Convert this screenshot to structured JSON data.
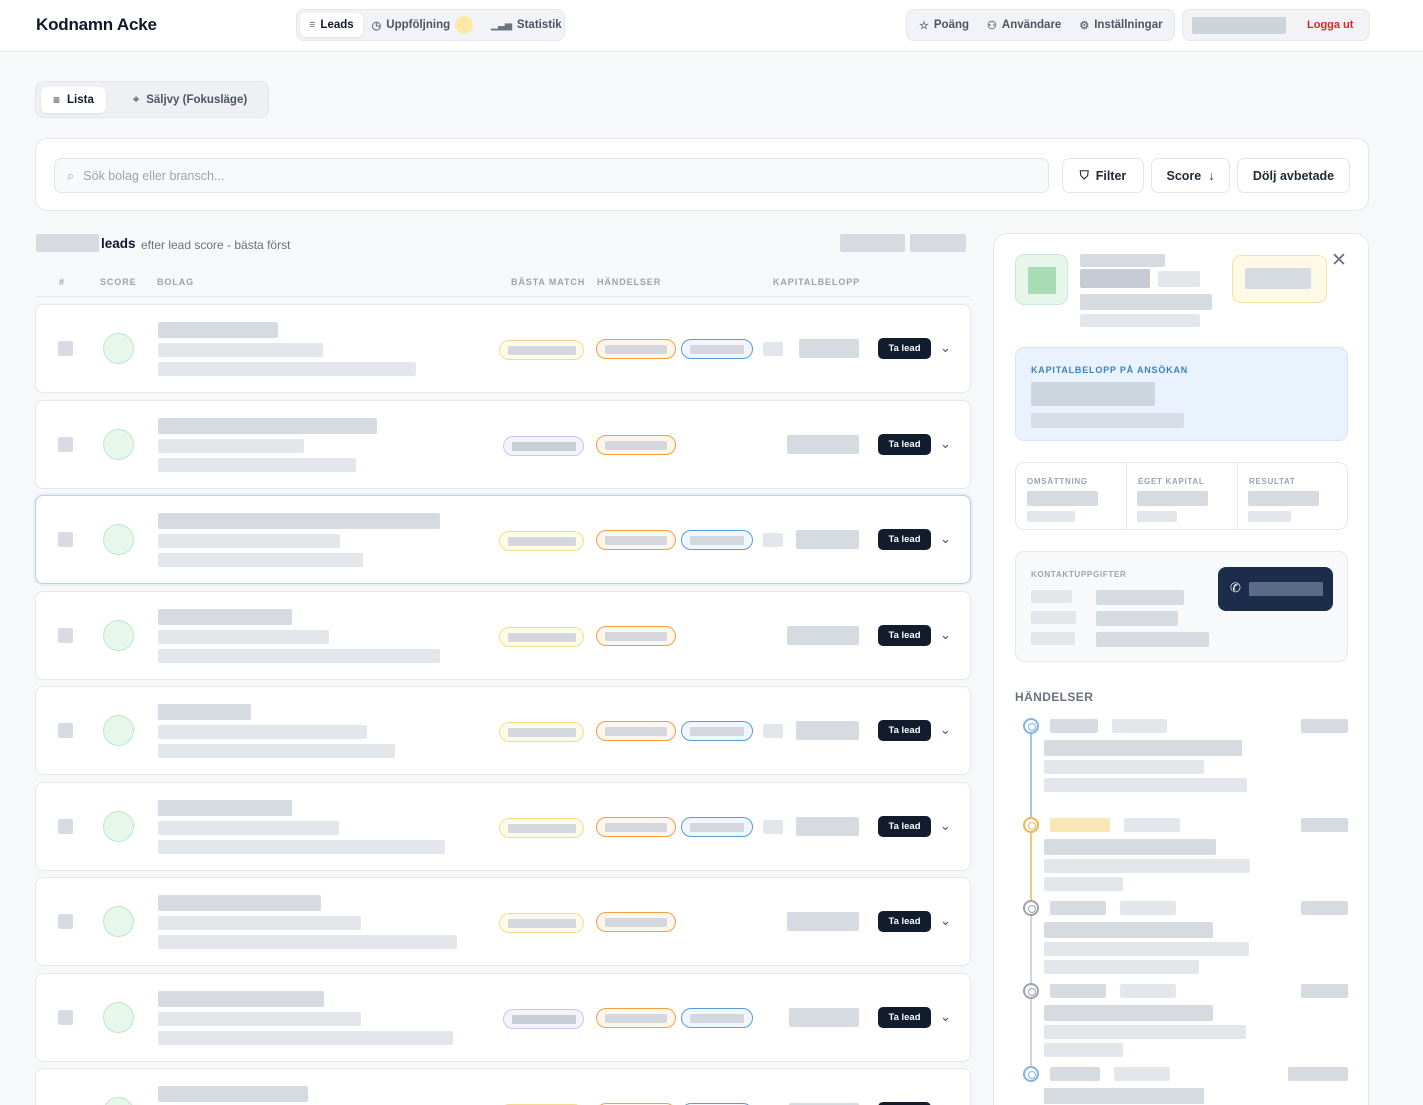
{
  "app": {
    "title": "Kodnamn Acke"
  },
  "nav": {
    "main": [
      {
        "label": "Leads",
        "icon": "list-icon",
        "active": true
      },
      {
        "label": "Uppföljning",
        "icon": "clock-icon",
        "active": false
      },
      {
        "label": "Statistik",
        "icon": "bar-chart-icon",
        "active": false
      }
    ],
    "secondary": [
      {
        "label": "Poäng",
        "icon": "star-icon"
      },
      {
        "label": "Användare",
        "icon": "users-icon"
      },
      {
        "label": "Inställningar",
        "icon": "gear-icon"
      }
    ],
    "logout": "Logga ut"
  },
  "view_toggle": {
    "list": "Lista",
    "focus": "Säljvy (Fokusläge)"
  },
  "search": {
    "placeholder": "Sök bolag eller bransch..."
  },
  "toolbar": {
    "filter": "Filter",
    "score": "Score",
    "hide": "Dölj avbetade"
  },
  "list": {
    "title": "leads",
    "subtitle": "efter lead score - bästa först",
    "columns": {
      "num": "#",
      "score": "SCORE",
      "company": "BOLAG",
      "match": "BÄSTA MATCH",
      "events": "HÄNDELSER",
      "capital": "KAPITALBELOPP"
    },
    "take_lead_label": "Ta lead"
  },
  "detail": {
    "capital_label": "KAPITALBELOPP PÅ ANSÖKAN",
    "financials": {
      "revenue": "OMSÄTTNING",
      "equity": "EGET KAPITAL",
      "result": "RESULTAT"
    },
    "contact_label": "KONTAKTUPPGIFTER",
    "events_title": "HÄNDELSER"
  },
  "colors": {
    "accent_dark": "#111c2e",
    "logout": "#dc2626",
    "tag_orange": "#f59e42",
    "tag_blue": "#5b9be0",
    "tag_yellow": "#f6dc8a",
    "kap_label": "#3b82c4"
  }
}
